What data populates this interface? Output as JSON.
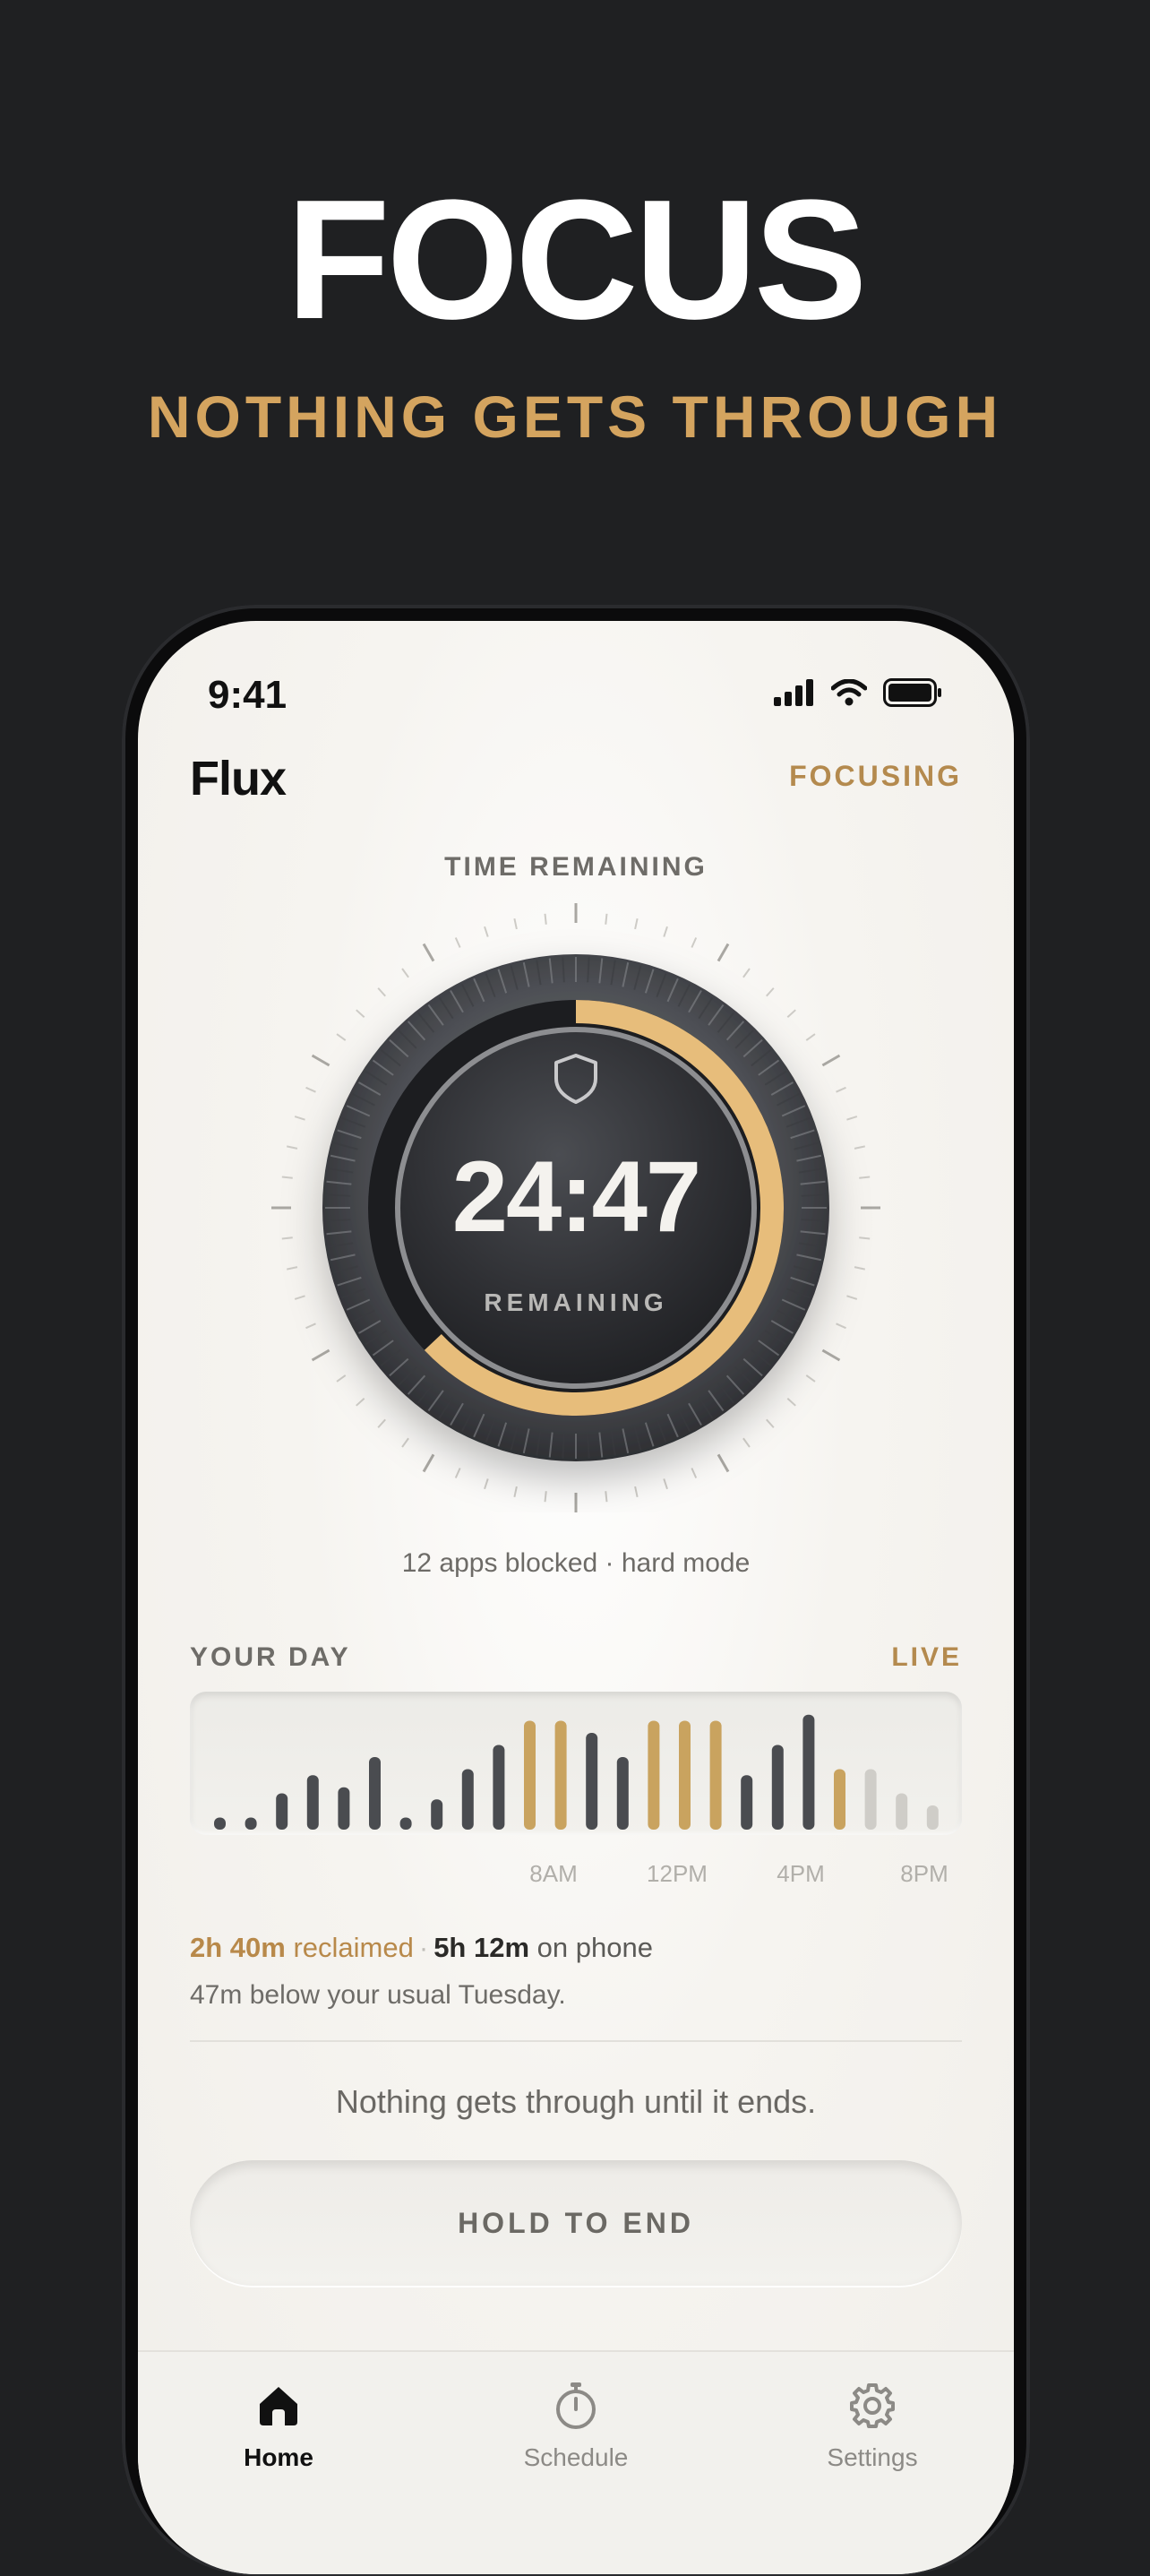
{
  "hero": {
    "title": "FOCUS",
    "subtitle": "NOTHING GETS THROUGH"
  },
  "status_bar": {
    "time": "9:41",
    "icons": [
      "signal-icon",
      "wifi-icon",
      "battery-icon"
    ]
  },
  "header": {
    "app_name": "Flux",
    "status": "FOCUSING"
  },
  "timer": {
    "label": "TIME REMAINING",
    "time": "24:47",
    "sub_label": "REMAINING",
    "progress_fraction": 0.63,
    "center_icon": "shield-icon"
  },
  "blocked_info": "12 apps blocked · hard mode",
  "your_day": {
    "label": "YOUR DAY",
    "live_label": "LIVE",
    "x_ticks": [
      "8AM",
      "12PM",
      "4PM",
      "8PM"
    ]
  },
  "chart_data": {
    "type": "bar",
    "title": "YOUR DAY",
    "values": [
      2,
      2,
      6,
      9,
      7,
      12,
      2,
      5,
      10,
      14,
      18,
      18,
      16,
      12,
      18,
      18,
      18,
      9,
      14,
      19,
      10,
      10,
      6,
      4
    ],
    "highlight": [
      false,
      false,
      false,
      false,
      false,
      false,
      false,
      false,
      false,
      false,
      true,
      true,
      false,
      false,
      true,
      true,
      true,
      false,
      false,
      false,
      true,
      false,
      false,
      false
    ],
    "past": [
      true,
      true,
      true,
      true,
      true,
      true,
      true,
      true,
      true,
      true,
      true,
      true,
      true,
      true,
      true,
      true,
      true,
      true,
      true,
      true,
      true,
      false,
      false,
      false
    ],
    "x_tick_labels": [
      "8AM",
      "12PM",
      "4PM",
      "8PM"
    ],
    "colors": {
      "highlight": "#c9a35f",
      "past": "#4a4c50",
      "future": "#cfcdc8"
    }
  },
  "stats": {
    "reclaimed_value": "2h 40m",
    "reclaimed_label": "reclaimed",
    "separator": "·",
    "phone_value": "5h 12m",
    "phone_label": "on phone",
    "comparison": "47m below your usual Tuesday."
  },
  "message": "Nothing gets through until it ends.",
  "hold_button": "HOLD TO END",
  "tabs": [
    {
      "label": "Home",
      "icon": "home-icon",
      "active": true
    },
    {
      "label": "Schedule",
      "icon": "stopwatch-icon",
      "active": false
    },
    {
      "label": "Settings",
      "icon": "gear-icon",
      "active": false
    }
  ],
  "colors": {
    "accent": "#d4a45f",
    "gold_text": "#b48a4e",
    "background": "#1f2022"
  }
}
